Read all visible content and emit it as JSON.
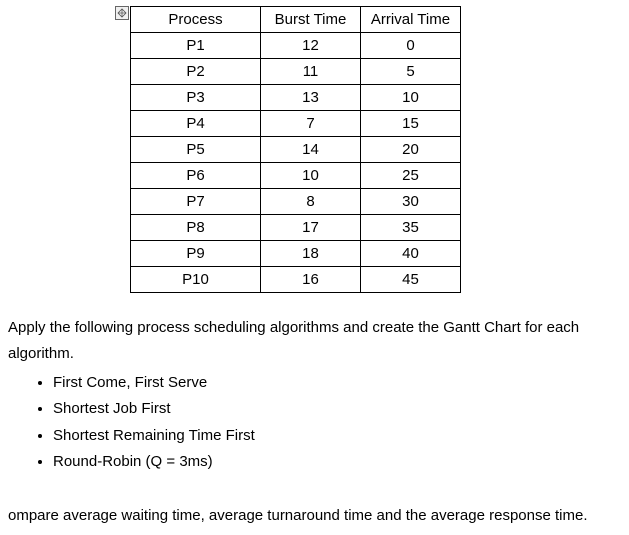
{
  "table": {
    "headers": {
      "process": "Process",
      "burst": "Burst Time",
      "arrival": "Arrival Time"
    },
    "rows": [
      {
        "process": "P1",
        "burst": "12",
        "arrival": "0"
      },
      {
        "process": "P2",
        "burst": "11",
        "arrival": "5"
      },
      {
        "process": "P3",
        "burst": "13",
        "arrival": "10"
      },
      {
        "process": "P4",
        "burst": "7",
        "arrival": "15"
      },
      {
        "process": "P5",
        "burst": "14",
        "arrival": "20"
      },
      {
        "process": "P6",
        "burst": "10",
        "arrival": "25"
      },
      {
        "process": "P7",
        "burst": "8",
        "arrival": "30"
      },
      {
        "process": "P8",
        "burst": "17",
        "arrival": "35"
      },
      {
        "process": "P9",
        "burst": "18",
        "arrival": "40"
      },
      {
        "process": "P10",
        "burst": "16",
        "arrival": "45"
      }
    ]
  },
  "text": {
    "intro1": "Apply the following process scheduling algorithms and create the Gantt Chart for each",
    "intro2": "algorithm.",
    "algos": [
      "First Come, First Serve",
      "Shortest Job First",
      "Shortest Remaining Time First",
      "Round-Robin (Q = 3ms)"
    ],
    "footer": "ompare average waiting time, average turnaround time and the average response time."
  }
}
